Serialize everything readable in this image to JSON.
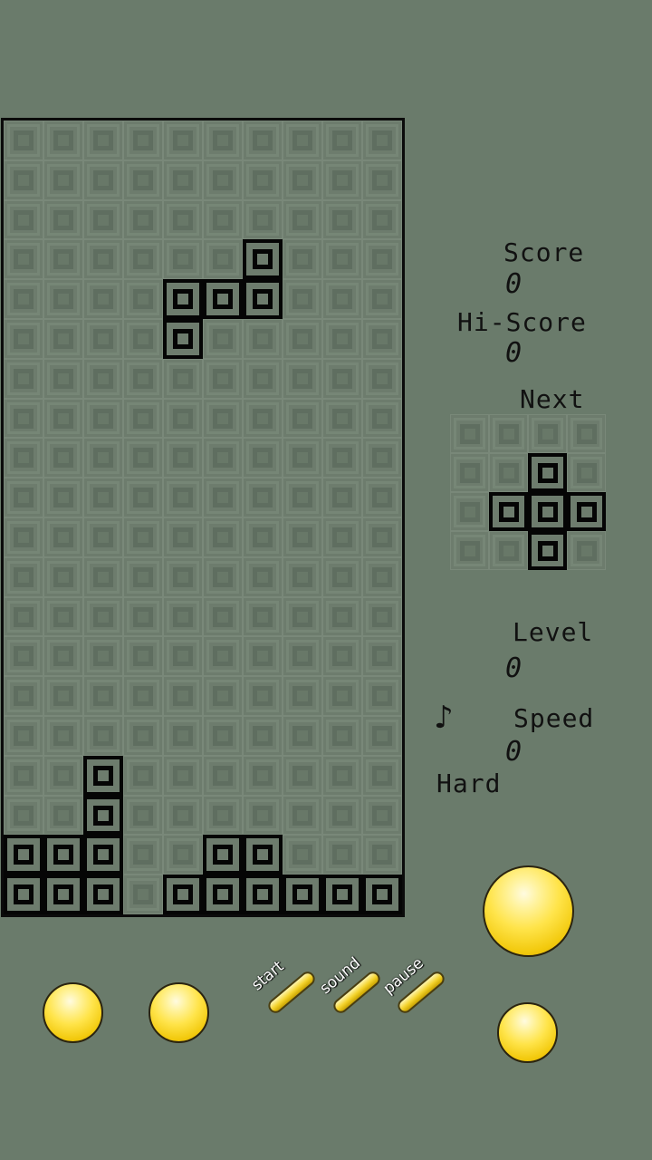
{
  "board": {
    "cols": 10,
    "rows": 20,
    "filled": [
      [
        3,
        6
      ],
      [
        4,
        4
      ],
      [
        4,
        5
      ],
      [
        4,
        6
      ],
      [
        5,
        4
      ],
      [
        16,
        2
      ],
      [
        17,
        2
      ],
      [
        18,
        0
      ],
      [
        18,
        1
      ],
      [
        18,
        2
      ],
      [
        18,
        5
      ],
      [
        18,
        6
      ],
      [
        19,
        0
      ],
      [
        19,
        1
      ],
      [
        19,
        2
      ],
      [
        19,
        4
      ],
      [
        19,
        5
      ],
      [
        19,
        6
      ],
      [
        19,
        7
      ],
      [
        19,
        8
      ],
      [
        19,
        9
      ]
    ]
  },
  "next": {
    "cols": 4,
    "rows": 4,
    "filled": [
      [
        1,
        2
      ],
      [
        2,
        1
      ],
      [
        2,
        2
      ],
      [
        2,
        3
      ],
      [
        3,
        2
      ]
    ]
  },
  "stats": {
    "score_label": "Score",
    "score_value": "0",
    "hiscore_label": "Hi-Score",
    "hiscore_value": "0",
    "next_label": "Next",
    "level_label": "Level",
    "level_value": "0",
    "speed_label": "Speed",
    "speed_value": "0",
    "difficulty": "Hard",
    "music_icon": "♪"
  },
  "controls": {
    "start_label": "start",
    "sound_label": "sound",
    "pause_label": "pause"
  }
}
